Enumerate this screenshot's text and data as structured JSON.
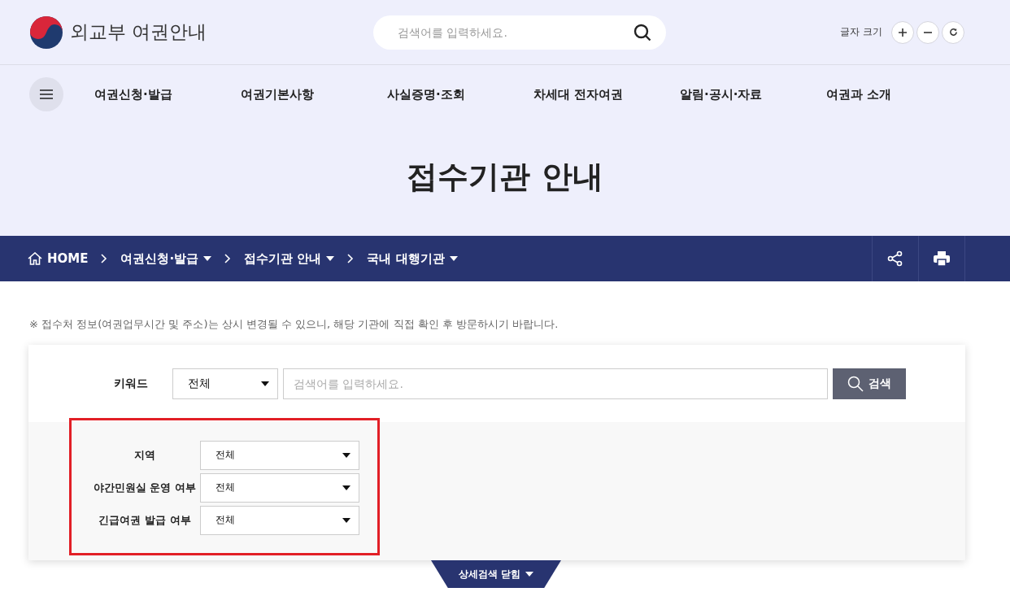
{
  "header": {
    "logo_text": "외교부 여권안내",
    "search": {
      "placeholder": "검색어를 입력하세요."
    },
    "font_size": {
      "label": "글자 크기"
    }
  },
  "nav": {
    "items": [
      "여권신청·발급",
      "여권기본사항",
      "사실증명·조회",
      "차세대 전자여권",
      "알림·공시·자료",
      "여권과 소개"
    ]
  },
  "page_title": "접수기관 안내",
  "breadcrumb": [
    {
      "label": "HOME",
      "kind": "home"
    },
    {
      "label": "여권신청·발급",
      "kind": "menu"
    },
    {
      "label": "접수기관 안내",
      "kind": "menu"
    },
    {
      "label": "국내 대행기관",
      "kind": "menu"
    }
  ],
  "notice": "※ 접수처 정보(여권업무시간 및 주소)는 상시 변경될 수 있으니, 해당 기관에 직접 확인 후 방문하시기 바랍니다.",
  "search_form": {
    "keyword_label": "키워드",
    "keyword_select": "전체",
    "keyword_placeholder": "검색어를 입력하세요.",
    "search_button": "검색",
    "filters": [
      {
        "label": "지역",
        "value": "전체"
      },
      {
        "label": "야간민원실 운영 여부",
        "value": "전체"
      },
      {
        "label": "긴급여권 발급 여부",
        "value": "전체"
      }
    ],
    "highlighted": true,
    "toggle": "상세검색 닫힘"
  }
}
